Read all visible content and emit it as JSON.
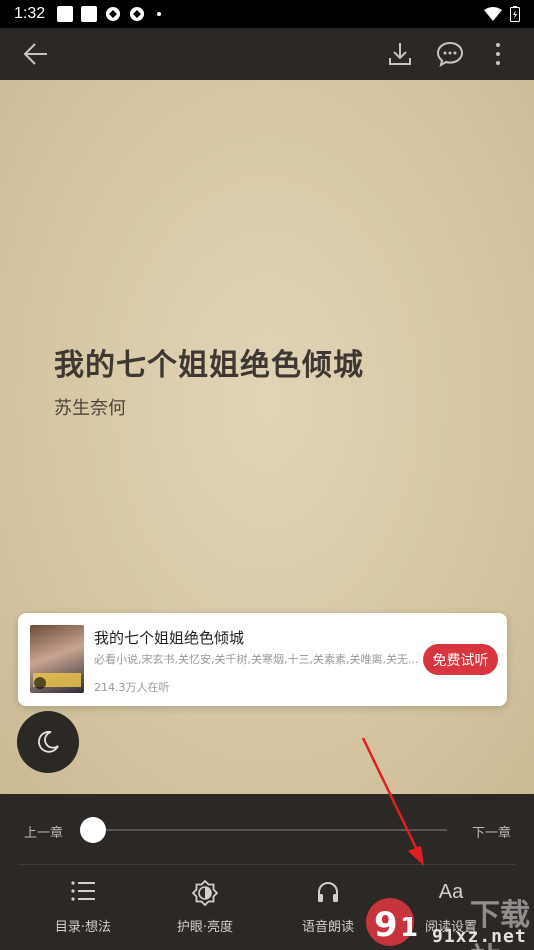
{
  "status_bar": {
    "time": "1:32"
  },
  "colors": {
    "accent": "#d8353f",
    "page_bg": "#d9caa6",
    "toolbar_bg": "#2b2826"
  },
  "top_bar": {
    "back_icon": "arrow-left-icon",
    "download_icon": "download-icon",
    "comment_icon": "comment-icon",
    "more_icon": "more-vertical-icon"
  },
  "book": {
    "title": "我的七个姐姐绝色倾城",
    "author": "苏生奈何"
  },
  "audio_card": {
    "title": "我的七个姐姐绝色倾城",
    "description": "必看小说,宋玄书,关忆安,关千树,关寒烟,十三,关素素,关唯离,关无...",
    "listeners": "214.3万人在听",
    "button_label": "免费试听"
  },
  "chapter_nav": {
    "prev_label": "上一章",
    "next_label": "下一章",
    "progress": 0.0
  },
  "bottom_nav": [
    {
      "label": "目录·想法",
      "icon": "list-icon"
    },
    {
      "label": "护眼·亮度",
      "icon": "brightness-icon"
    },
    {
      "label": "语音朗读",
      "icon": "headphones-icon"
    },
    {
      "label": "阅读设置",
      "icon": "font-size-icon",
      "glyph": "Aa"
    }
  ],
  "watermark": {
    "text": "91xz.net",
    "cn": "下载站"
  }
}
